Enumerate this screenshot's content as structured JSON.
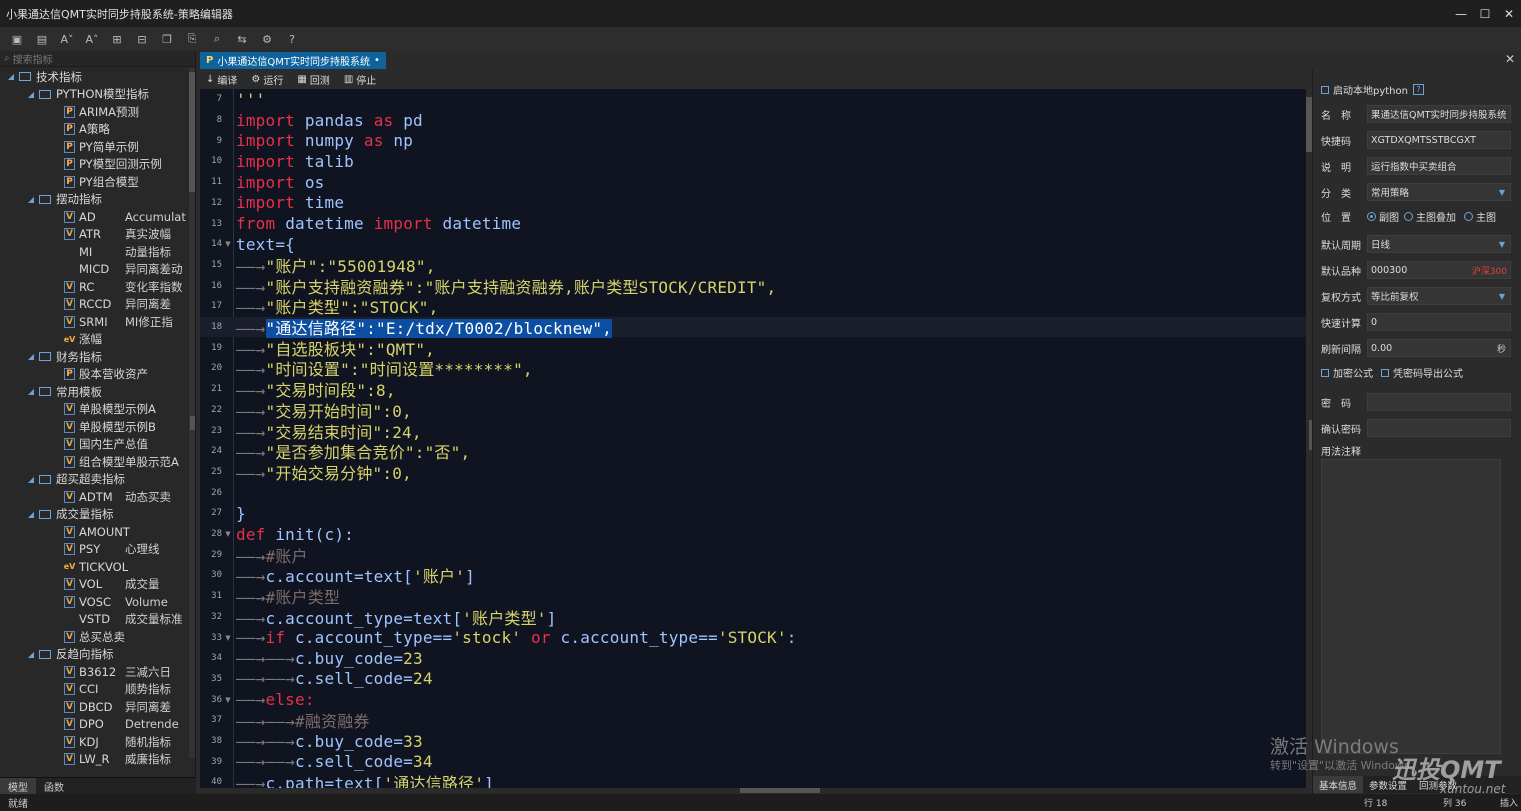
{
  "window": {
    "title": "小果通达信QMT实时同步持股系统-策略编辑器",
    "min": "—",
    "max": "☐",
    "close": "✕"
  },
  "toolbar": {
    "icons": [
      "save-icon",
      "save-all-icon",
      "font-decrease-icon",
      "font-increase-icon",
      "import-icon",
      "export-icon",
      "copy-icon",
      "paste-icon",
      "find-icon",
      "replace-icon",
      "settings-icon",
      "help-icon"
    ]
  },
  "left": {
    "search_placeholder": "搜索指标",
    "tree": [
      {
        "type": "group",
        "level": 0,
        "label": "技术指标"
      },
      {
        "type": "group",
        "level": 1,
        "label": "PYTHON模型指标"
      },
      {
        "type": "item",
        "badge": "P",
        "code": "ARIMA预测",
        "desc": ""
      },
      {
        "type": "item",
        "badge": "P",
        "code": "A策略",
        "desc": ""
      },
      {
        "type": "item",
        "badge": "P",
        "code": "PY简单示例",
        "desc": ""
      },
      {
        "type": "item",
        "badge": "P",
        "code": "PY模型回测示例",
        "desc": ""
      },
      {
        "type": "item",
        "badge": "P",
        "code": "PY组合模型",
        "desc": ""
      },
      {
        "type": "group",
        "level": 1,
        "label": "摆动指标"
      },
      {
        "type": "item",
        "badge": "V",
        "code": "AD",
        "desc": "Accumulat"
      },
      {
        "type": "item",
        "badge": "V",
        "code": "ATR",
        "desc": "真实波幅"
      },
      {
        "type": "item",
        "badge": "",
        "code": "MI",
        "desc": "动量指标"
      },
      {
        "type": "item",
        "badge": "",
        "code": "MICD",
        "desc": "异同离差动"
      },
      {
        "type": "item",
        "badge": "V",
        "code": "RC",
        "desc": "变化率指数"
      },
      {
        "type": "item",
        "badge": "V",
        "code": "RCCD",
        "desc": "异同离差"
      },
      {
        "type": "item",
        "badge": "V",
        "code": "SRMI",
        "desc": "MI修正指"
      },
      {
        "type": "item",
        "badge": "eV",
        "code": "涨幅",
        "desc": ""
      },
      {
        "type": "group",
        "level": 1,
        "label": "财务指标"
      },
      {
        "type": "item",
        "badge": "P",
        "code": "股本营收资产",
        "desc": ""
      },
      {
        "type": "group",
        "level": 1,
        "label": "常用模板"
      },
      {
        "type": "item",
        "badge": "V",
        "code": "单股模型示例A",
        "desc": ""
      },
      {
        "type": "item",
        "badge": "V",
        "code": "单股模型示例B",
        "desc": ""
      },
      {
        "type": "item",
        "badge": "V",
        "code": "国内生产总值",
        "desc": ""
      },
      {
        "type": "item",
        "badge": "V",
        "code": "组合模型单股示范A",
        "desc": ""
      },
      {
        "type": "group",
        "level": 1,
        "label": "超买超卖指标"
      },
      {
        "type": "item",
        "badge": "V",
        "code": "ADTM",
        "desc": "动态买卖"
      },
      {
        "type": "group",
        "level": 1,
        "label": "成交量指标"
      },
      {
        "type": "item",
        "badge": "V",
        "code": "AMOUNT",
        "desc": ""
      },
      {
        "type": "item",
        "badge": "V",
        "code": "PSY",
        "desc": "心理线"
      },
      {
        "type": "item",
        "badge": "eV",
        "code": "TICKVOL",
        "desc": ""
      },
      {
        "type": "item",
        "badge": "V",
        "code": "VOL",
        "desc": "成交量"
      },
      {
        "type": "item",
        "badge": "V",
        "code": "VOSC",
        "desc": "Volume"
      },
      {
        "type": "item",
        "badge": "",
        "code": "VSTD",
        "desc": "成交量标准"
      },
      {
        "type": "item",
        "badge": "V",
        "code": "总买总卖",
        "desc": ""
      },
      {
        "type": "group",
        "level": 1,
        "label": "反趋向指标"
      },
      {
        "type": "item",
        "badge": "V",
        "code": "B3612",
        "desc": "三减六日"
      },
      {
        "type": "item",
        "badge": "V",
        "code": "CCI",
        "desc": "顺势指标"
      },
      {
        "type": "item",
        "badge": "V",
        "code": "DBCD",
        "desc": "异同离差"
      },
      {
        "type": "item",
        "badge": "V",
        "code": "DPO",
        "desc": "Detrende"
      },
      {
        "type": "item",
        "badge": "V",
        "code": "KDJ",
        "desc": "随机指标"
      },
      {
        "type": "item",
        "badge": "V",
        "code": "LW_R",
        "desc": "威廉指标"
      }
    ],
    "tabs": [
      "模型",
      "函数"
    ]
  },
  "doc_tab": {
    "label": "小果通达信QMT实时同步持股系统",
    "close": "•"
  },
  "editor_toolbar": {
    "compile": "编译",
    "run": "运行",
    "backtest": "回测",
    "stop": "停止"
  },
  "editor": {
    "lines": [
      {
        "n": 7,
        "html": "<span class='str'>'''</span>"
      },
      {
        "n": 8,
        "html": "<span class='kw'>import</span> <span class='pl'>pandas</span> <span class='kw'>as</span> <span class='pl'>pd</span>"
      },
      {
        "n": 9,
        "html": "<span class='kw'>import</span> <span class='pl'>numpy</span> <span class='kw'>as</span> <span class='pl'>np</span>"
      },
      {
        "n": 10,
        "html": "<span class='kw'>import</span> <span class='pl'>talib</span>"
      },
      {
        "n": 11,
        "html": "<span class='kw'>import</span> <span class='pl'>os</span>"
      },
      {
        "n": 12,
        "html": "<span class='kw'>import</span> <span class='pl'>time</span>"
      },
      {
        "n": 13,
        "html": "<span class='kw'>from</span> <span class='pl'>datetime</span> <span class='kw'>import</span> <span class='pl'>datetime</span>"
      },
      {
        "n": 14,
        "html": "<span class='pl'>text={</span>",
        "fold": true
      },
      {
        "n": 15,
        "html": "<span class='ar'>——→</span><span class='str'>\"账户\":\"55001948\",</span>"
      },
      {
        "n": 16,
        "html": "<span class='ar'>——→</span><span class='str'>\"账户支持融资融券\":\"账户支持融资融券,账户类型STOCK/CREDIT\",</span>"
      },
      {
        "n": 17,
        "html": "<span class='ar'>——→</span><span class='str'>\"账户类型\":\"STOCK\",</span>"
      },
      {
        "n": 18,
        "html": "<span class='ar'>——→</span><span class='hl'>\"通达信路径\":\"E:/tdx/T0002/blocknew\",</span>",
        "cur": true
      },
      {
        "n": 19,
        "html": "<span class='ar'>——→</span><span class='str'>\"自选股板块\":\"QMT\",</span>"
      },
      {
        "n": 20,
        "html": "<span class='ar'>——→</span><span class='str'>\"时间设置\":\"时间设置********\",</span>"
      },
      {
        "n": 21,
        "html": "<span class='ar'>——→</span><span class='str'>\"交易时间段\":8,</span>"
      },
      {
        "n": 22,
        "html": "<span class='ar'>——→</span><span class='str'>\"交易开始时间\":0,</span>"
      },
      {
        "n": 23,
        "html": "<span class='ar'>——→</span><span class='str'>\"交易结束时间\":24,</span>"
      },
      {
        "n": 24,
        "html": "<span class='ar'>——→</span><span class='str'>\"是否参加集合竞价\":\"否\",</span>"
      },
      {
        "n": 25,
        "html": "<span class='ar'>——→</span><span class='str'>\"开始交易分钟\":0,</span>"
      },
      {
        "n": 26,
        "html": ""
      },
      {
        "n": 27,
        "html": "<span class='pl'>}</span>"
      },
      {
        "n": 28,
        "html": "<span class='kw'>def</span> <span class='pl'>init(c):</span>",
        "fold": true
      },
      {
        "n": 29,
        "html": "<span class='ar'>——→</span><span class='cm'>#账户</span>"
      },
      {
        "n": 30,
        "html": "<span class='ar'>——→</span><span class='pl'>c.account=text[</span><span class='str'>'账户'</span><span class='pl'>]</span>"
      },
      {
        "n": 31,
        "html": "<span class='ar'>——→</span><span class='cm'>#账户类型</span>"
      },
      {
        "n": 32,
        "html": "<span class='ar'>——→</span><span class='pl'>c.account_type=text[</span><span class='str'>'账户类型'</span><span class='pl'>]</span>"
      },
      {
        "n": 33,
        "html": "<span class='ar'>——→</span><span class='kw'>if</span> <span class='pl'>c.account_type==</span><span class='str'>'stock'</span> <span class='kw'>or</span> <span class='pl'>c.account_type==</span><span class='str'>'STOCK'</span><span class='pl'>:</span>",
        "fold": true
      },
      {
        "n": 34,
        "html": "<span class='ar'>——→——→</span><span class='pl'>c.buy_code=</span><span class='str'>23</span>"
      },
      {
        "n": 35,
        "html": "<span class='ar'>——→——→</span><span class='pl'>c.sell_code=</span><span class='str'>24</span>"
      },
      {
        "n": 36,
        "html": "<span class='ar'>——→</span><span class='kw'>else:</span>",
        "fold": true
      },
      {
        "n": 37,
        "html": "<span class='ar'>——→——→</span><span class='cm'>#融资融券</span>"
      },
      {
        "n": 38,
        "html": "<span class='ar'>——→——→</span><span class='pl'>c.buy_code=</span><span class='str'>33</span>"
      },
      {
        "n": 39,
        "html": "<span class='ar'>——→——→</span><span class='pl'>c.sell_code=</span><span class='str'>34</span>"
      },
      {
        "n": 40,
        "html": "<span class='ar'>——→</span><span class='pl'>c.path=text[</span><span class='str'>'通达信路径'</span><span class='pl'>]</span>"
      }
    ]
  },
  "right": {
    "local_python": "启动本地python",
    "help": "?",
    "name_label": "名　称",
    "name_value": "果通达信QMT实时同步持股系统",
    "shortcut_label": "快捷码",
    "shortcut_value": "XGTDXQMTSSTBCGXT",
    "desc_label": "说　明",
    "desc_value": "运行指数中买卖组合",
    "cat_label": "分　类",
    "cat_value": "常用策略",
    "pos_label": "位　置",
    "pos_options": [
      "副图",
      "主图叠加",
      "主图"
    ],
    "period_label": "默认周期",
    "period_value": "日线",
    "variety_label": "默认品种",
    "variety_value": "000300",
    "variety_name": "沪深300",
    "adjust_label": "复权方式",
    "adjust_value": "等比前复权",
    "fast_label": "快速计算",
    "fast_value": "0",
    "refresh_label": "刷新间隔",
    "refresh_value": "0.00",
    "refresh_unit": "秒",
    "encrypt": "加密公式",
    "export_pwd": "凭密码导出公式",
    "pwd_label": "密　码",
    "confirm_label": "确认密码",
    "notes_label": "用法注释",
    "tabs": [
      "基本信息",
      "参数设置",
      "回测参数"
    ]
  },
  "status": {
    "left": "就绪",
    "row": "行 18",
    "col": "列 36",
    "mode": "插入"
  },
  "watermark": {
    "line1": "激活 Windows",
    "line2": "转到\"设置\"以激活 Windows。",
    "brand": "迅投QMT",
    "brand_sub": "xuntou.net"
  }
}
